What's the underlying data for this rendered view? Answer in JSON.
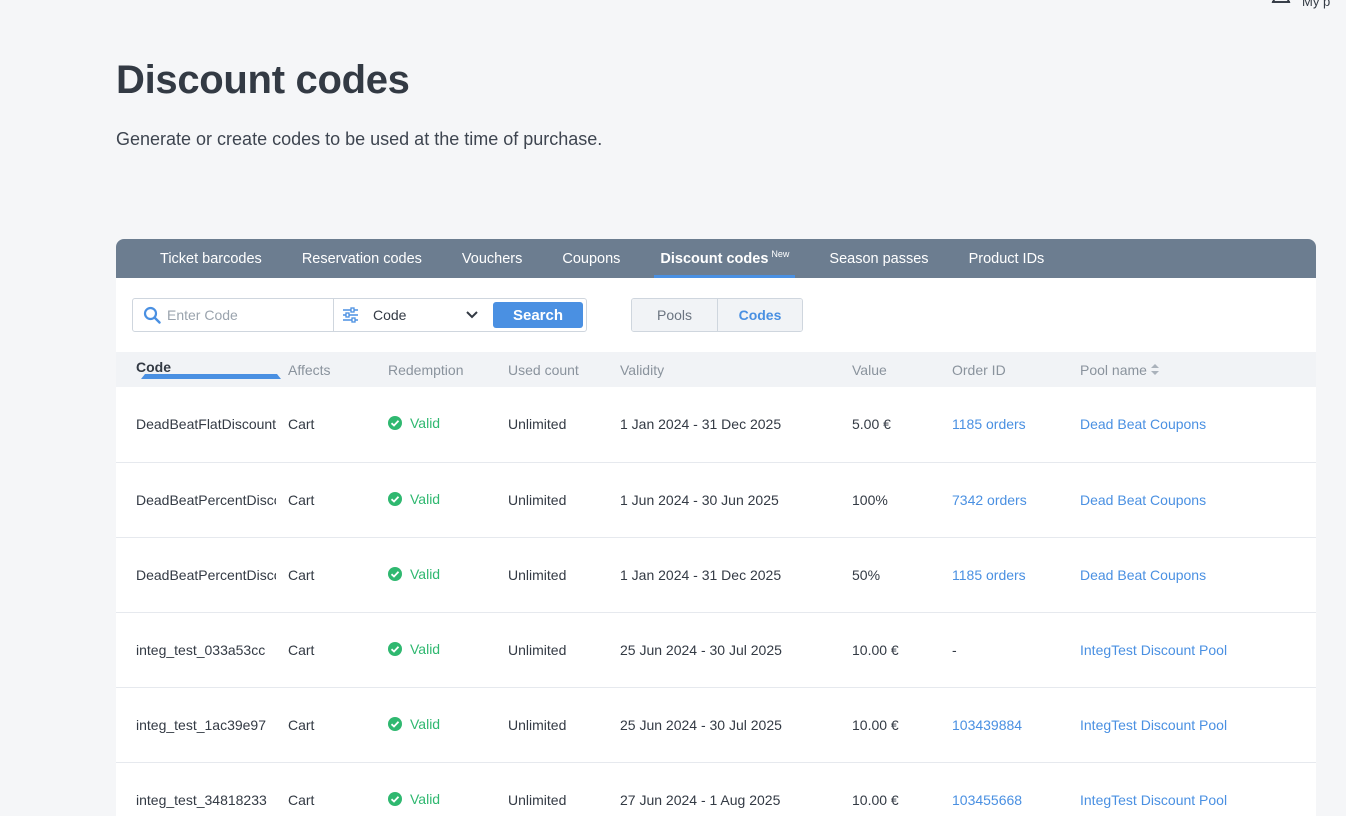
{
  "header": {
    "user_label": "My p"
  },
  "page": {
    "title": "Discount codes",
    "subtitle": "Generate or create codes to be used at the time of purchase."
  },
  "tabs": [
    {
      "label": "Ticket barcodes",
      "active": false
    },
    {
      "label": "Reservation codes",
      "active": false
    },
    {
      "label": "Vouchers",
      "active": false
    },
    {
      "label": "Coupons",
      "active": false
    },
    {
      "label": "Discount codes",
      "badge": "New",
      "active": true
    },
    {
      "label": "Season passes",
      "active": false
    },
    {
      "label": "Product IDs",
      "active": false
    }
  ],
  "search": {
    "placeholder": "Enter Code",
    "value": "",
    "filter_selected": "Code",
    "button_label": "Search"
  },
  "view_toggle": {
    "options": [
      "Pools",
      "Codes"
    ],
    "selected": "Codes"
  },
  "table": {
    "columns": [
      "Code",
      "Affects",
      "Redemption",
      "Used count",
      "Validity",
      "Value",
      "Order ID",
      "Pool name"
    ],
    "sorted_by": "Code",
    "rows": [
      {
        "code": "DeadBeatFlatDiscount",
        "affects": "Cart",
        "redemption": "Valid",
        "used": "Unlimited",
        "validity": "1 Jan 2024 - 31 Dec 2025",
        "value": "5.00 €",
        "order": "1185 orders",
        "pool": "Dead Beat Coupons"
      },
      {
        "code": "DeadBeatPercentDiscount",
        "affects": "Cart",
        "redemption": "Valid",
        "used": "Unlimited",
        "validity": "1 Jun 2024 - 30 Jun 2025",
        "value": "100%",
        "order": "7342 orders",
        "pool": "Dead Beat Coupons"
      },
      {
        "code": "DeadBeatPercentDiscount",
        "affects": "Cart",
        "redemption": "Valid",
        "used": "Unlimited",
        "validity": "1 Jan 2024 - 31 Dec 2025",
        "value": "50%",
        "order": "1185 orders",
        "pool": "Dead Beat Coupons"
      },
      {
        "code": "integ_test_033a53cc",
        "affects": "Cart",
        "redemption": "Valid",
        "used": "Unlimited",
        "validity": "25 Jun 2024 - 30 Jul 2025",
        "value": "10.00 €",
        "order": "-",
        "pool": "IntegTest Discount Pool"
      },
      {
        "code": "integ_test_1ac39e97",
        "affects": "Cart",
        "redemption": "Valid",
        "used": "Unlimited",
        "validity": "25 Jun 2024 - 30 Jul 2025",
        "value": "10.00 €",
        "order": "103439884",
        "pool": "IntegTest Discount Pool"
      },
      {
        "code": "integ_test_34818233",
        "affects": "Cart",
        "redemption": "Valid",
        "used": "Unlimited",
        "validity": "27 Jun 2024 - 1 Aug 2025",
        "value": "10.00 €",
        "order": "103455668",
        "pool": "IntegTest Discount Pool"
      }
    ]
  }
}
